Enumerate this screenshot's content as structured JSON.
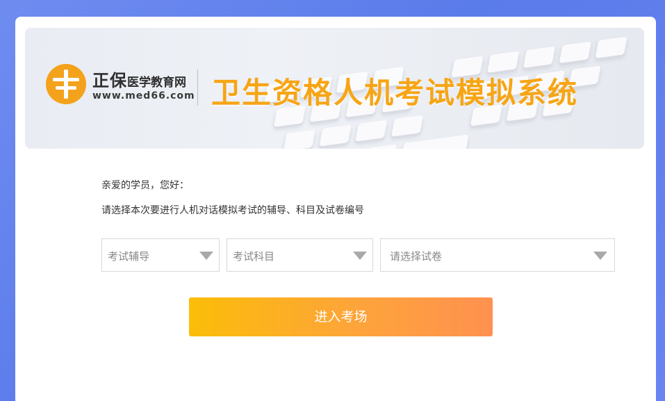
{
  "header": {
    "brand_name": "正保",
    "brand_suffix": "医学教育网",
    "brand_url": "www.med66.com",
    "system_title": "卫生资格人机考试模拟系统"
  },
  "intro": {
    "greeting": "亲爱的学员，您好：",
    "instruction": "请选择本次要进行人机对话模拟考试的辅导、科目及试卷编号"
  },
  "selects": {
    "course": {
      "value": "考试辅导"
    },
    "subject": {
      "value": "考试科目"
    },
    "paper": {
      "value": "请选择试卷"
    }
  },
  "actions": {
    "enter_label": "进入考场"
  },
  "colors": {
    "accent": "#f7a515",
    "button_start": "#fbbd08",
    "button_end": "#ff9150",
    "background": "#6f8cf0"
  },
  "icons": {
    "logo": "med66-logo-icon",
    "dropdown": "triangle-down-icon"
  }
}
